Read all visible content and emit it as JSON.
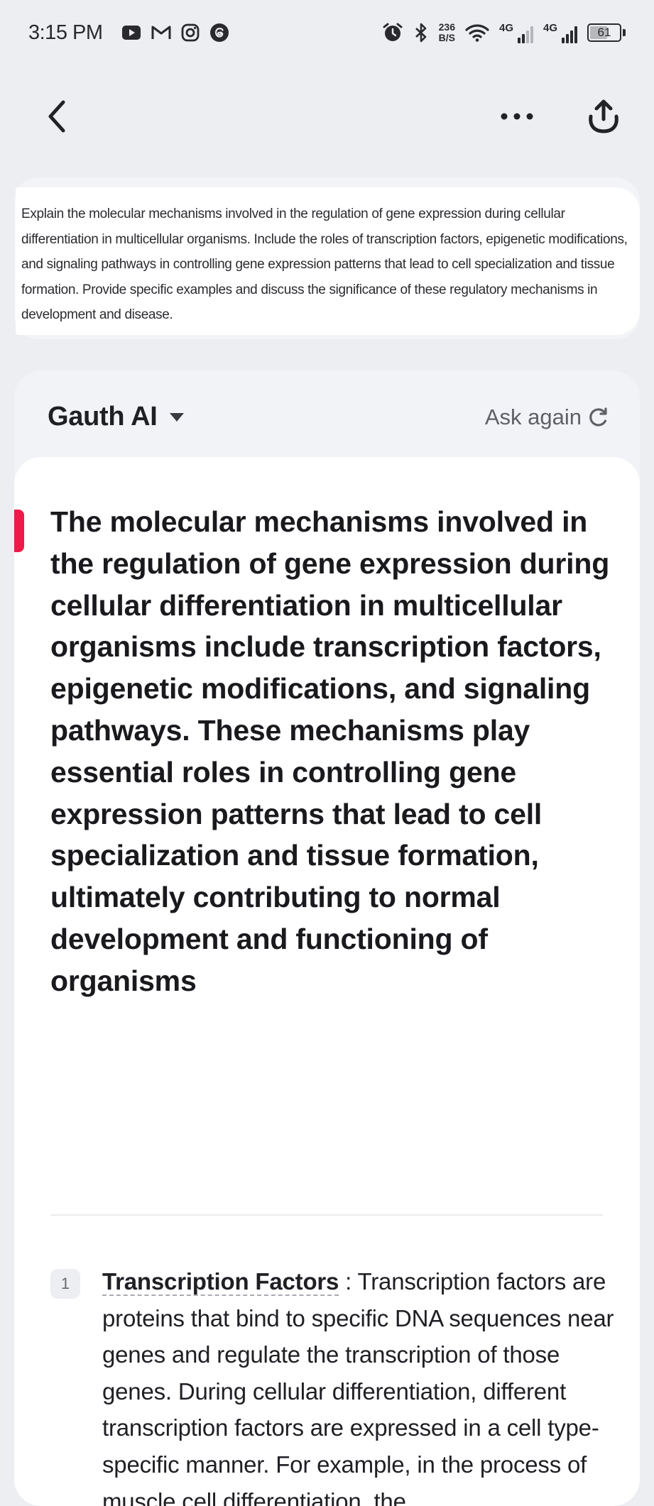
{
  "status_bar": {
    "time": "3:15 PM",
    "net_speed_value": "236",
    "net_speed_unit": "B/S",
    "signal1_label": "4G",
    "signal2_label": "4G",
    "battery_level": "61"
  },
  "icons": {
    "notification_icons": [
      "youtube-icon",
      "gmail-icon",
      "instagram-icon",
      "threads-icon"
    ],
    "status_icons": [
      "alarm-icon",
      "bluetooth-icon",
      "wifi-icon"
    ]
  },
  "question": {
    "text": "Explain the molecular mechanisms involved in the regulation of gene expression during cellular differentiation in multicellular organisms. Include the roles of transcription factors, epigenetic modifications, and signaling pathways in controlling gene expression patterns that lead to cell specialization and tissue formation. Provide specific examples and discuss the significance of these regulatory mechanisms in development and disease."
  },
  "answer": {
    "model_name": "Gauth AI",
    "ask_again_label": "Ask again",
    "summary": "The molecular mechanisms involved in the regulation of gene expression during cellular differentiation in multicellular organisms include transcription factors, epigenetic modifications, and signaling pathways. These mechanisms play essential roles in controlling gene expression patterns that lead to cell specialization and tissue formation, ultimately contributing to normal development and functioning of organisms",
    "steps": [
      {
        "number": "1",
        "term": "Transcription Factors",
        "text": " : Transcription factors are proteins that bind to specific DNA sequences near genes and regulate the transcription of those genes. During cellular differentiation, different transcription factors are expressed in a cell type-specific manner. For example, in the process of muscle cell differentiation, the"
      }
    ]
  },
  "colors": {
    "accent": "#ef1a48",
    "page_background": "#eceef2",
    "card_background": "#ffffff"
  }
}
